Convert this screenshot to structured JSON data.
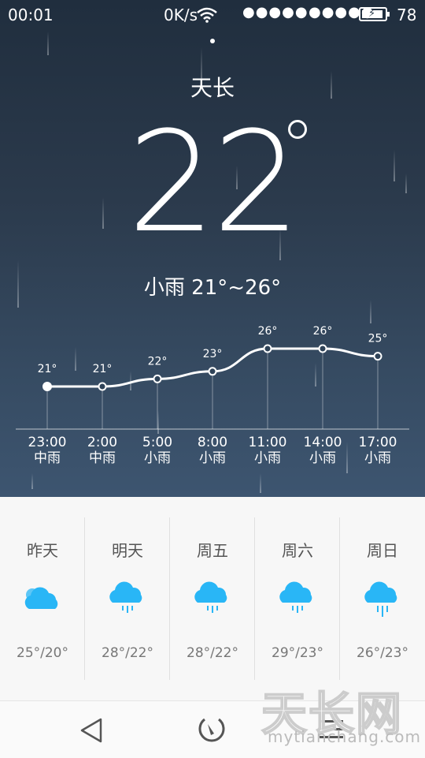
{
  "status_bar": {
    "time": "00:01",
    "net_speed": "0K/s",
    "signal_1": "●●●●●",
    "signal_2": "●●●●●",
    "battery_level": "78"
  },
  "weather": {
    "city": "天长",
    "temperature": "22",
    "condition_range": "小雨 21°~26°"
  },
  "hourly": [
    {
      "time": "23:00",
      "cond": "中雨",
      "temp": 21
    },
    {
      "time": "2:00",
      "cond": "中雨",
      "temp": 21
    },
    {
      "time": "5:00",
      "cond": "小雨",
      "temp": 22
    },
    {
      "time": "8:00",
      "cond": "小雨",
      "temp": 23
    },
    {
      "time": "11:00",
      "cond": "小雨",
      "temp": 26
    },
    {
      "time": "14:00",
      "cond": "小雨",
      "temp": 26
    },
    {
      "time": "17:00",
      "cond": "小雨",
      "temp": 25
    }
  ],
  "hourly_temp_suffix": "°",
  "daily": [
    {
      "name": "昨天",
      "range": "25°/20°",
      "icon": "cloudy-icon"
    },
    {
      "name": "明天",
      "range": "28°/22°",
      "icon": "light-rain-icon"
    },
    {
      "name": "周五",
      "range": "28°/22°",
      "icon": "light-rain-icon"
    },
    {
      "name": "周六",
      "range": "29°/23°",
      "icon": "light-rain-icon"
    },
    {
      "name": "周日",
      "range": "26°/23°",
      "icon": "rain-icon"
    }
  ],
  "watermark": {
    "big": "天长网",
    "small": "mytianchang.com"
  },
  "colors": {
    "accent_blue": "#29b6f6",
    "sky_top": "#202e3e",
    "sky_bottom": "#3d5570"
  }
}
